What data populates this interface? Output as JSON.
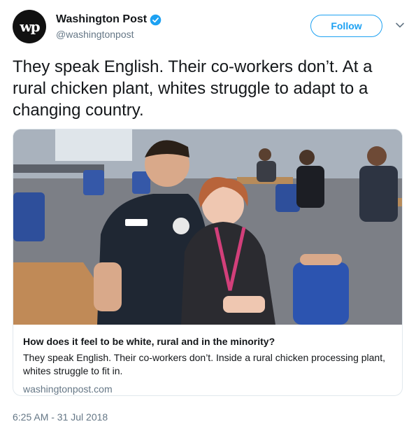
{
  "author": {
    "display_name": "Washington Post",
    "handle": "@washingtonpost",
    "avatar_text": "wp",
    "verified": true
  },
  "actions": {
    "follow_label": "Follow"
  },
  "tweet": {
    "text": "They speak English. Their co-workers don’t. At a rural chicken plant, whites struggle to adapt to a changing country.",
    "timestamp": "6:25 AM - 31 Jul 2018"
  },
  "card": {
    "title": "How does it feel to be white, rural and in the minority?",
    "description": "They speak English. Their co-workers don’t. Inside a rural chicken processing plant, whites struggle to fit in.",
    "domain": "washingtonpost.com",
    "image_subject": "photo-of-couple-in-plant-cafeteria"
  },
  "colors": {
    "accent": "#1da1f2",
    "text_primary": "#14171a",
    "text_secondary": "#657786",
    "border": "#e1e8ed"
  }
}
